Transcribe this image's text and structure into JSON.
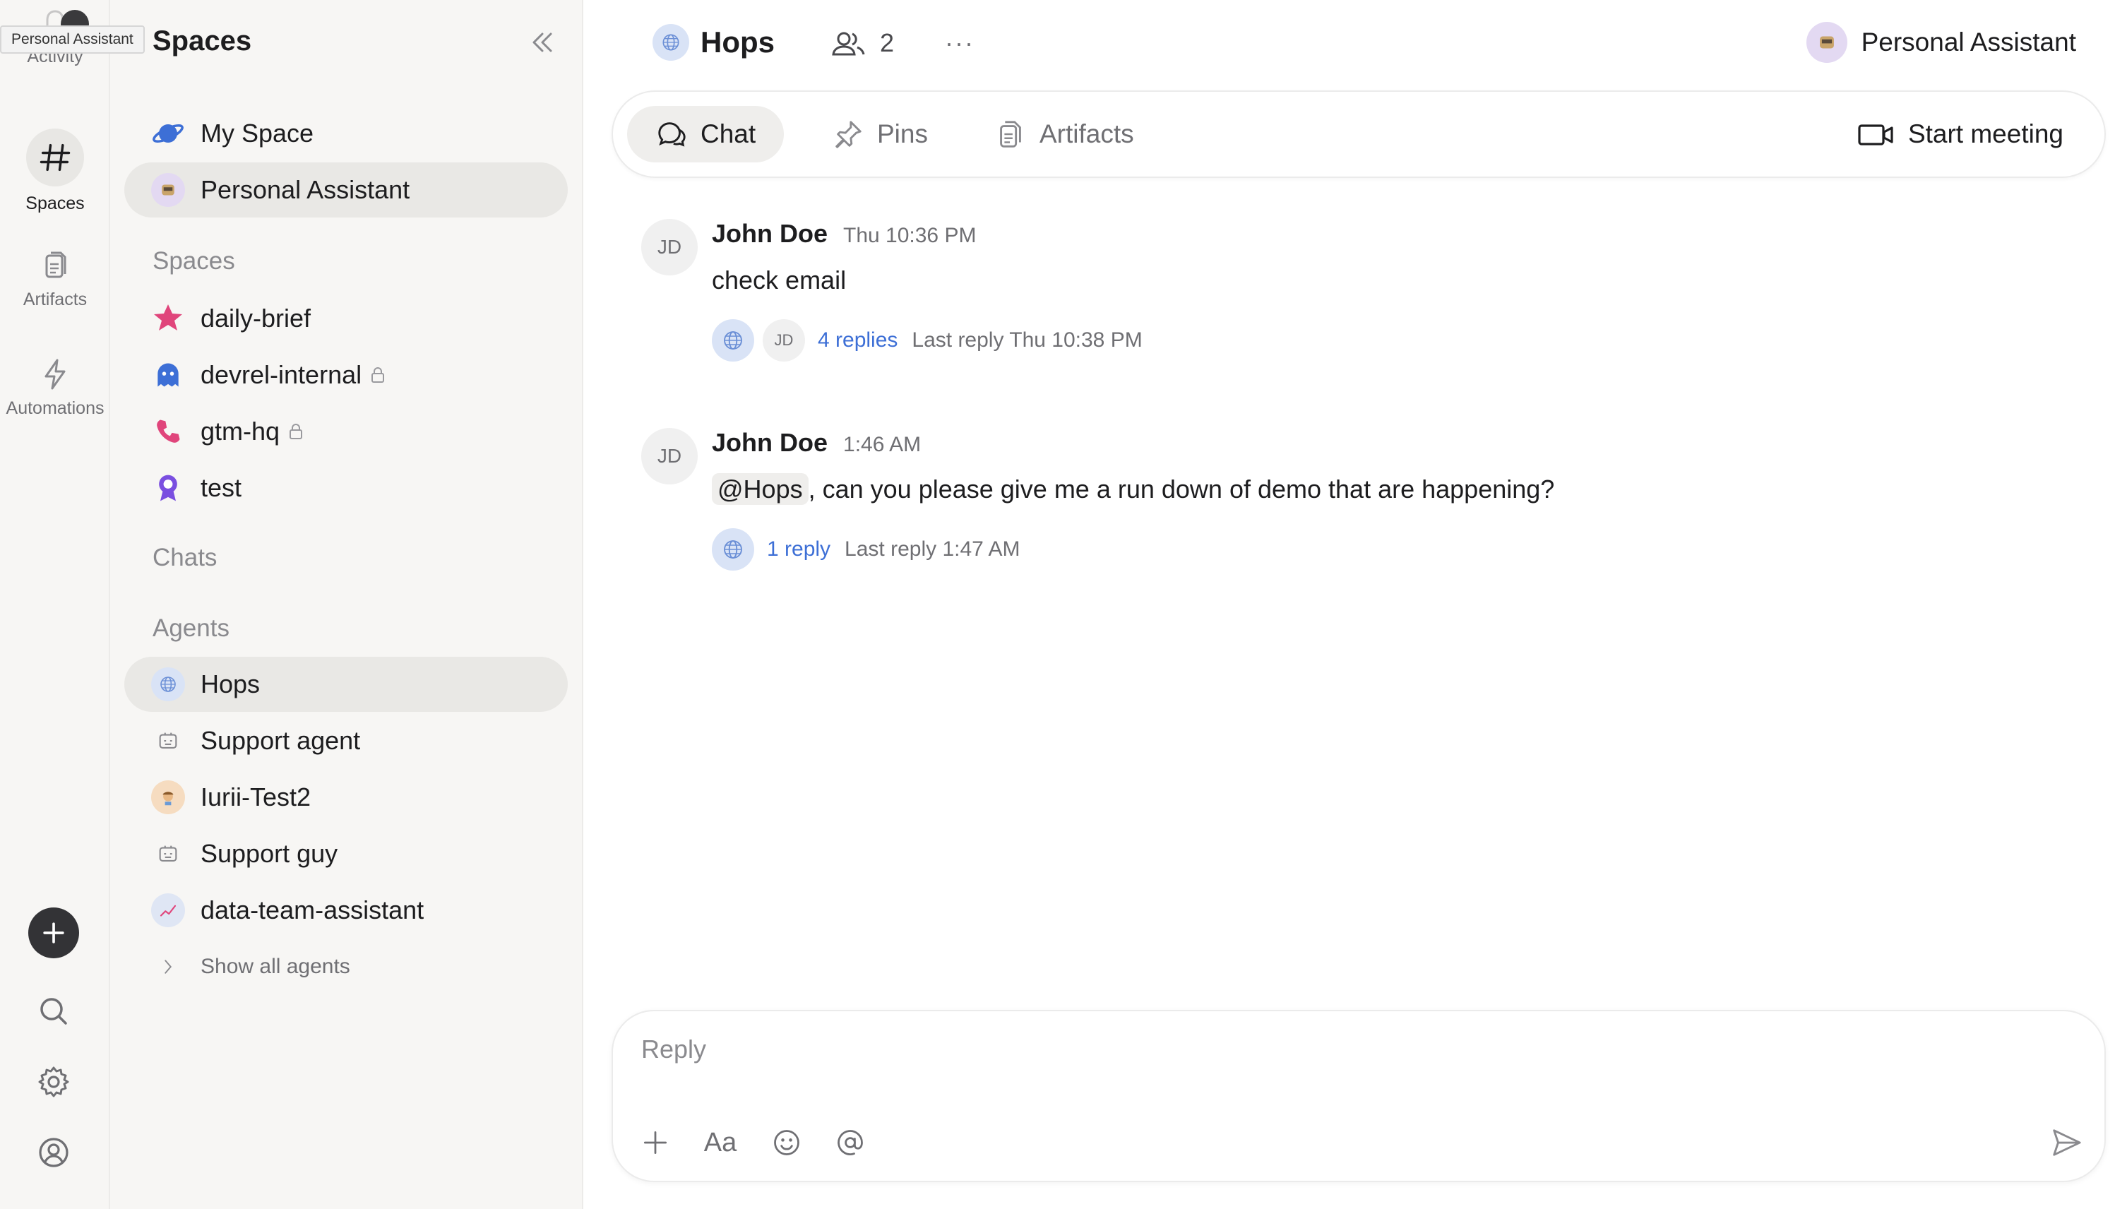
{
  "tooltip": "Personal Assistant",
  "rail": {
    "items": [
      {
        "label": "Activity"
      },
      {
        "label": "Spaces"
      },
      {
        "label": "Artifacts"
      },
      {
        "label": "Automations"
      }
    ]
  },
  "sidebar": {
    "title": "Spaces",
    "top_items": [
      {
        "label": "My Space",
        "icon": "planet-icon"
      },
      {
        "label": "Personal Assistant",
        "icon": "assistant-avatar"
      }
    ],
    "spaces_header": "Spaces",
    "spaces": [
      {
        "label": "daily-brief",
        "icon": "star-icon",
        "locked": false
      },
      {
        "label": "devrel-internal",
        "icon": "ghost-icon",
        "locked": true
      },
      {
        "label": "gtm-hq",
        "icon": "phone-icon",
        "locked": true
      },
      {
        "label": "test",
        "icon": "award-icon",
        "locked": false
      }
    ],
    "chats_header": "Chats",
    "agents_header": "Agents",
    "agents": [
      {
        "label": "Hops",
        "icon": "globe-avatar"
      },
      {
        "label": "Support agent",
        "icon": "bot-icon"
      },
      {
        "label": "Iurii-Test2",
        "icon": "agent-avatar"
      },
      {
        "label": "Support guy",
        "icon": "bot-icon"
      },
      {
        "label": "data-team-assistant",
        "icon": "chart-avatar"
      }
    ],
    "show_all": "Show all agents"
  },
  "header": {
    "title": "Hops",
    "member_count": "2",
    "more": "···",
    "assistant_label": "Personal Assistant"
  },
  "tabs": [
    {
      "label": "Chat",
      "active": true
    },
    {
      "label": "Pins",
      "active": false
    },
    {
      "label": "Artifacts",
      "active": false
    }
  ],
  "start_meeting": "Start meeting",
  "messages": [
    {
      "initials": "JD",
      "author": "John Doe",
      "time": "Thu 10:36 PM",
      "text": "check email",
      "replies": "4 replies",
      "last_reply": "Last reply Thu 10:38 PM",
      "reply_avatar_initials": "JD"
    },
    {
      "initials": "JD",
      "author": "John Doe",
      "time": "1:46 AM",
      "mention": "@Hops",
      "text": ", can you please give me a run down of demo that are happening?",
      "replies": "1 reply",
      "last_reply": "Last reply 1:47 AM"
    }
  ],
  "composer": {
    "placeholder": "Reply",
    "format_label": "Aa"
  },
  "colors": {
    "accent_link": "#3d6fd6",
    "sidebar_bg": "#f7f6f4",
    "selected_bg": "#e9e8e5"
  }
}
